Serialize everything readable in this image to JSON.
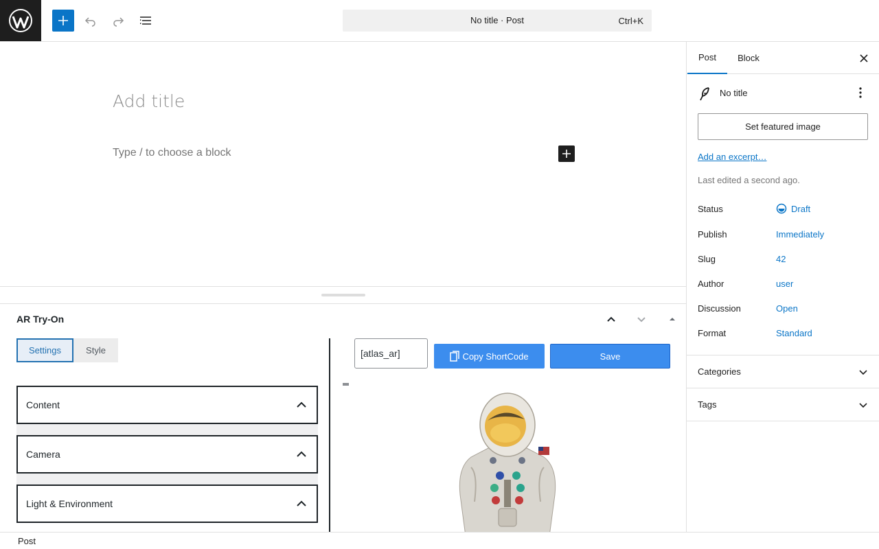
{
  "toolbar": {
    "logo_icon": "wordpress-logo-icon",
    "inserter_icon": "plus-icon",
    "undo_icon": "undo-icon",
    "redo_icon": "redo-icon",
    "list_view_icon": "list-view-icon",
    "command_title": "No title · Post",
    "command_shortcut": "Ctrl+K"
  },
  "editor": {
    "title_placeholder": "Add title",
    "block_placeholder": "Type / to choose a block"
  },
  "metabox": {
    "title": "AR Try-On",
    "tabs": [
      {
        "label": "Settings",
        "active": true
      },
      {
        "label": "Style",
        "active": false
      }
    ],
    "accordions": [
      {
        "label": "Content"
      },
      {
        "label": "Camera"
      },
      {
        "label": "Light & Environment"
      }
    ],
    "shortcode_value": "[atlas_ar]",
    "copy_label": "Copy ShortCode",
    "save_label": "Save"
  },
  "sidebar": {
    "tabs": [
      {
        "label": "Post",
        "active": true
      },
      {
        "label": "Block",
        "active": false
      }
    ],
    "post_name": "No title",
    "featured_image_label": "Set featured image",
    "excerpt_label": "Add an excerpt…",
    "last_edited": "Last edited a second ago.",
    "meta": [
      {
        "label": "Status",
        "value": "Draft"
      },
      {
        "label": "Publish",
        "value": "Immediately"
      },
      {
        "label": "Slug",
        "value": "42"
      },
      {
        "label": "Author",
        "value": "user"
      },
      {
        "label": "Discussion",
        "value": "Open"
      },
      {
        "label": "Format",
        "value": "Standard"
      }
    ],
    "panels": [
      {
        "label": "Categories"
      },
      {
        "label": "Tags"
      }
    ]
  },
  "footer": {
    "breadcrumb": "Post"
  },
  "colors": {
    "accent": "#0a75c7",
    "metabox_button": "#3c8dee",
    "dark": "#1e1e1e"
  }
}
